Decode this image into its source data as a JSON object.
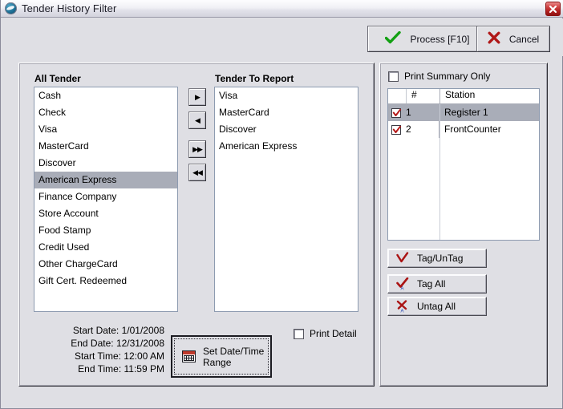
{
  "window": {
    "title": "Tender History Filter",
    "icon": "app-swoosh-icon",
    "close_label": "×"
  },
  "toolbar": {
    "process_label": "Process [F10]",
    "process_icon": "green-check-icon",
    "cancel_label": "Cancel",
    "cancel_icon": "red-x-icon"
  },
  "all_tender": {
    "label": "All Tender",
    "items": [
      "Cash",
      "Check",
      "Visa",
      "MasterCard",
      "Discover",
      "American Express",
      "Finance Company",
      "Store Account",
      "Food Stamp",
      "Credit Used",
      "Other ChargeCard",
      "Gift Cert. Redeemed"
    ],
    "selected_index": 5
  },
  "transfer_buttons": [
    {
      "name": "move-right-button",
      "glyph": "▶"
    },
    {
      "name": "move-left-button",
      "glyph": "◀"
    },
    {
      "name": "move-all-right-button",
      "glyph": "▶▶"
    },
    {
      "name": "move-all-left-button",
      "glyph": "◀◀"
    }
  ],
  "tender_to_report": {
    "label": "Tender To Report",
    "items": [
      "Visa",
      "MasterCard",
      "Discover",
      "American Express"
    ]
  },
  "date_range": {
    "start_date_label": "Start Date:",
    "start_date_value": "1/01/2008",
    "end_date_label": "End Date:",
    "end_date_value": "12/31/2008",
    "start_time_label": "Start Time:",
    "start_time_value": "12:00 AM",
    "end_time_label": "End Time:",
    "end_time_value": "11:59 PM",
    "button_line1": "Set Date/Time",
    "button_line2": "Range",
    "button_icon": "calendar-icon"
  },
  "print_detail": {
    "label": "Print Detail",
    "checked": false
  },
  "print_summary_only": {
    "label": "Print Summary Only",
    "checked": false
  },
  "station_grid": {
    "columns": [
      "",
      "#",
      "Station"
    ],
    "rows": [
      {
        "checked": true,
        "num": "1",
        "station": "Register 1",
        "selected": true
      },
      {
        "checked": true,
        "num": "2",
        "station": "FrontCounter",
        "selected": false
      }
    ]
  },
  "tag_buttons": [
    {
      "name": "tag-untag-button",
      "label": "Tag/UnTag",
      "icon": "red-check-icon"
    },
    {
      "name": "tag-all-button",
      "label": "Tag All",
      "icon": "red-check-all-icon"
    },
    {
      "name": "untag-all-button",
      "label": "Untag All",
      "icon": "red-x-all-icon"
    }
  ],
  "colors": {
    "window_bg": "#dfdfe4",
    "selection": "#a9adb8",
    "accent_red": "#b11e1e",
    "accent_green": "#1b9d1b",
    "list_bg": "#ffffff"
  }
}
